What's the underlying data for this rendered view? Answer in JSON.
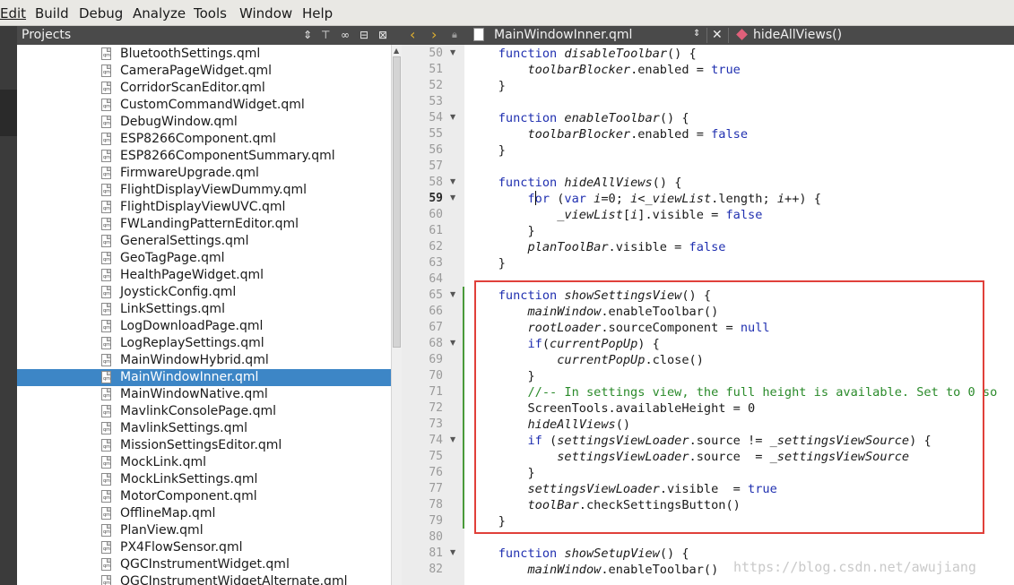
{
  "menubar": {
    "items": [
      {
        "label": "Edit"
      },
      {
        "label": "Build"
      },
      {
        "label": "Debug"
      },
      {
        "label": "Analyze"
      },
      {
        "label": "Tools"
      },
      {
        "label": "Window"
      },
      {
        "label": "Help"
      }
    ]
  },
  "projects_panel": {
    "title": "Projects",
    "selected_file": "MainWindowInner.qml",
    "files": [
      "BluetoothSettings.qml",
      "CameraPageWidget.qml",
      "CorridorScanEditor.qml",
      "CustomCommandWidget.qml",
      "DebugWindow.qml",
      "ESP8266Component.qml",
      "ESP8266ComponentSummary.qml",
      "FirmwareUpgrade.qml",
      "FlightDisplayViewDummy.qml",
      "FlightDisplayViewUVC.qml",
      "FWLandingPatternEditor.qml",
      "GeneralSettings.qml",
      "GeoTagPage.qml",
      "HealthPageWidget.qml",
      "JoystickConfig.qml",
      "LinkSettings.qml",
      "LogDownloadPage.qml",
      "LogReplaySettings.qml",
      "MainWindowHybrid.qml",
      "MainWindowInner.qml",
      "MainWindowNative.qml",
      "MavlinkConsolePage.qml",
      "MavlinkSettings.qml",
      "MissionSettingsEditor.qml",
      "MockLink.qml",
      "MockLinkSettings.qml",
      "MotorComponent.qml",
      "OfflineMap.qml",
      "PlanView.qml",
      "PX4FlowSensor.qml",
      "QGCInstrumentWidget.qml",
      "QGCInstrumentWidgetAlternate.qml"
    ],
    "file_icon_text": "qml"
  },
  "editor": {
    "open_file": "MainWindowInner.qml",
    "current_symbol": "hideAllViews()",
    "current_line": 59,
    "watermark": "https://blog.csdn.net/awujiang"
  },
  "code_lines": [
    {
      "n": "50",
      "fold": true,
      "parts": [
        [
          "",
          "    "
        ],
        [
          "k",
          "function "
        ],
        [
          "i",
          "disableToolbar"
        ],
        [
          "",
          "() {"
        ]
      ]
    },
    {
      "n": "51",
      "fold": false,
      "parts": [
        [
          "",
          "        "
        ],
        [
          "i",
          "toolbarBlocker"
        ],
        [
          "",
          ".enabled = "
        ],
        [
          "k",
          "true"
        ]
      ]
    },
    {
      "n": "52",
      "fold": false,
      "parts": [
        [
          "",
          "    }"
        ]
      ]
    },
    {
      "n": "53",
      "fold": false,
      "parts": []
    },
    {
      "n": "54",
      "fold": true,
      "parts": [
        [
          "",
          "    "
        ],
        [
          "k",
          "function "
        ],
        [
          "i",
          "enableToolbar"
        ],
        [
          "",
          "() {"
        ]
      ]
    },
    {
      "n": "55",
      "fold": false,
      "parts": [
        [
          "",
          "        "
        ],
        [
          "i",
          "toolbarBlocker"
        ],
        [
          "",
          ".enabled = "
        ],
        [
          "k",
          "false"
        ]
      ]
    },
    {
      "n": "56",
      "fold": false,
      "parts": [
        [
          "",
          "    }"
        ]
      ]
    },
    {
      "n": "57",
      "fold": false,
      "parts": []
    },
    {
      "n": "58",
      "fold": true,
      "parts": [
        [
          "",
          "    "
        ],
        [
          "k",
          "function "
        ],
        [
          "i",
          "hideAllViews"
        ],
        [
          "",
          "() {"
        ]
      ]
    },
    {
      "n": "59",
      "fold": true,
      "parts": [
        [
          "",
          "        "
        ],
        [
          "k",
          "for "
        ],
        [
          "",
          "("
        ],
        [
          "k",
          "var "
        ],
        [
          "i",
          "i"
        ],
        [
          "",
          "=0; "
        ],
        [
          "i",
          "i"
        ],
        [
          "",
          "<"
        ],
        [
          "i",
          "_viewList"
        ],
        [
          "",
          ".length; "
        ],
        [
          "i",
          "i"
        ],
        [
          "",
          "++) {"
        ]
      ]
    },
    {
      "n": "60",
      "fold": false,
      "parts": [
        [
          "",
          "            "
        ],
        [
          "i",
          "_viewList"
        ],
        [
          "",
          "["
        ],
        [
          "i",
          "i"
        ],
        [
          "",
          "].visible = "
        ],
        [
          "k",
          "false"
        ]
      ]
    },
    {
      "n": "61",
      "fold": false,
      "parts": [
        [
          "",
          "        }"
        ]
      ]
    },
    {
      "n": "62",
      "fold": false,
      "parts": [
        [
          "",
          "        "
        ],
        [
          "i",
          "planToolBar"
        ],
        [
          "",
          ".visible = "
        ],
        [
          "k",
          "false"
        ]
      ]
    },
    {
      "n": "63",
      "fold": false,
      "parts": [
        [
          "",
          "    }"
        ]
      ]
    },
    {
      "n": "64",
      "fold": false,
      "parts": []
    },
    {
      "n": "65",
      "fold": true,
      "parts": [
        [
          "",
          "    "
        ],
        [
          "k",
          "function "
        ],
        [
          "i",
          "showSettingsView"
        ],
        [
          "",
          "() {"
        ]
      ]
    },
    {
      "n": "66",
      "fold": false,
      "parts": [
        [
          "",
          "        "
        ],
        [
          "i",
          "mainWindow"
        ],
        [
          "",
          ".enableToolbar()"
        ]
      ]
    },
    {
      "n": "67",
      "fold": false,
      "parts": [
        [
          "",
          "        "
        ],
        [
          "i",
          "rootLoader"
        ],
        [
          "",
          ".sourceComponent = "
        ],
        [
          "k",
          "null"
        ]
      ]
    },
    {
      "n": "68",
      "fold": true,
      "parts": [
        [
          "",
          "        "
        ],
        [
          "k",
          "if"
        ],
        [
          "",
          "("
        ],
        [
          "i",
          "currentPopUp"
        ],
        [
          "",
          ") {"
        ]
      ]
    },
    {
      "n": "69",
      "fold": false,
      "parts": [
        [
          "",
          "            "
        ],
        [
          "i",
          "currentPopUp"
        ],
        [
          "",
          ".close()"
        ]
      ]
    },
    {
      "n": "70",
      "fold": false,
      "parts": [
        [
          "",
          "        }"
        ]
      ]
    },
    {
      "n": "71",
      "fold": false,
      "parts": [
        [
          "",
          "        "
        ],
        [
          "c",
          "//-- In settings view, the full height is available. Set to 0 so"
        ]
      ]
    },
    {
      "n": "72",
      "fold": false,
      "parts": [
        [
          "",
          "        ScreenTools.availableHeight = 0"
        ]
      ]
    },
    {
      "n": "73",
      "fold": false,
      "parts": [
        [
          "",
          "        "
        ],
        [
          "i",
          "hideAllViews"
        ],
        [
          "",
          "()"
        ]
      ]
    },
    {
      "n": "74",
      "fold": true,
      "parts": [
        [
          "",
          "        "
        ],
        [
          "k",
          "if "
        ],
        [
          "",
          "("
        ],
        [
          "i",
          "settingsViewLoader"
        ],
        [
          "",
          ".source != "
        ],
        [
          "i",
          "_settingsViewSource"
        ],
        [
          "",
          ") {"
        ]
      ]
    },
    {
      "n": "75",
      "fold": false,
      "parts": [
        [
          "",
          "            "
        ],
        [
          "i",
          "settingsViewLoader"
        ],
        [
          "",
          ".source  = "
        ],
        [
          "i",
          "_settingsViewSource"
        ]
      ]
    },
    {
      "n": "76",
      "fold": false,
      "parts": [
        [
          "",
          "        }"
        ]
      ]
    },
    {
      "n": "77",
      "fold": false,
      "parts": [
        [
          "",
          "        "
        ],
        [
          "i",
          "settingsViewLoader"
        ],
        [
          "",
          ".visible  = "
        ],
        [
          "k",
          "true"
        ]
      ]
    },
    {
      "n": "78",
      "fold": false,
      "parts": [
        [
          "",
          "        "
        ],
        [
          "i",
          "toolBar"
        ],
        [
          "",
          ".checkSettingsButton()"
        ]
      ]
    },
    {
      "n": "79",
      "fold": false,
      "parts": [
        [
          "",
          "    }"
        ]
      ]
    },
    {
      "n": "80",
      "fold": false,
      "parts": []
    },
    {
      "n": "81",
      "fold": true,
      "parts": [
        [
          "",
          "    "
        ],
        [
          "k",
          "function "
        ],
        [
          "i",
          "showSetupView"
        ],
        [
          "",
          "() {"
        ]
      ]
    },
    {
      "n": "82",
      "fold": false,
      "parts": [
        [
          "",
          "        "
        ],
        [
          "i",
          "mainWindow"
        ],
        [
          "",
          ".enableToolbar()"
        ]
      ]
    }
  ],
  "colors": {
    "keyword": "#2030b0",
    "comment": "#2a8a2a",
    "selection": "#3d86c6",
    "highlight_box": "#e0403a"
  }
}
